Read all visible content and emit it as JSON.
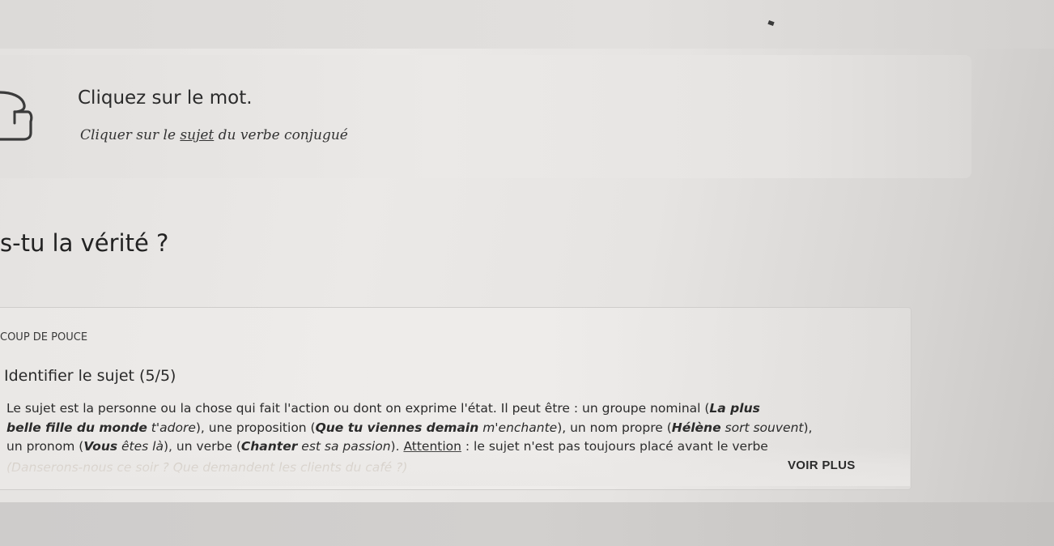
{
  "instruction": {
    "title": "Cliquez sur le mot.",
    "subtitle_before": "Cliquer sur le ",
    "subtitle_keyword": "sujet",
    "subtitle_after": " du verbe conjugué"
  },
  "question": {
    "text": "s-tu la vérité ?"
  },
  "hint": {
    "kicker": "COUP DE POUCE",
    "title": "Identifier le sujet (5/5)",
    "line1_a": "Le sujet est la personne ou la chose qui fait l'action ou dont on exprime l'état. Il peut être : un groupe nominal (",
    "line1_b": "La plus",
    "line2_a": "belle fille du monde",
    "line2_b": " t'adore",
    "line2_c": "), une proposition (",
    "line2_d": "Que tu viennes demain",
    "line2_e": " m'enchante",
    "line2_f": "), un nom propre (",
    "line2_g": "Hélène",
    "line2_h": " sort souvent",
    "line2_i": "),",
    "line3_a": "un pronom (",
    "line3_b": "Vous",
    "line3_c": " êtes là",
    "line3_d": "), un verbe (",
    "line3_e": "Chanter",
    "line3_f": " est sa passion",
    "line3_g": "). ",
    "line3_h": "Attention",
    "line3_i": " : le sujet n'est pas toujours placé avant le verbe",
    "line4": "(Danserons-nous ce soir ? Que demandent les clients du café ?)",
    "more_label": "VOIR PLUS"
  }
}
